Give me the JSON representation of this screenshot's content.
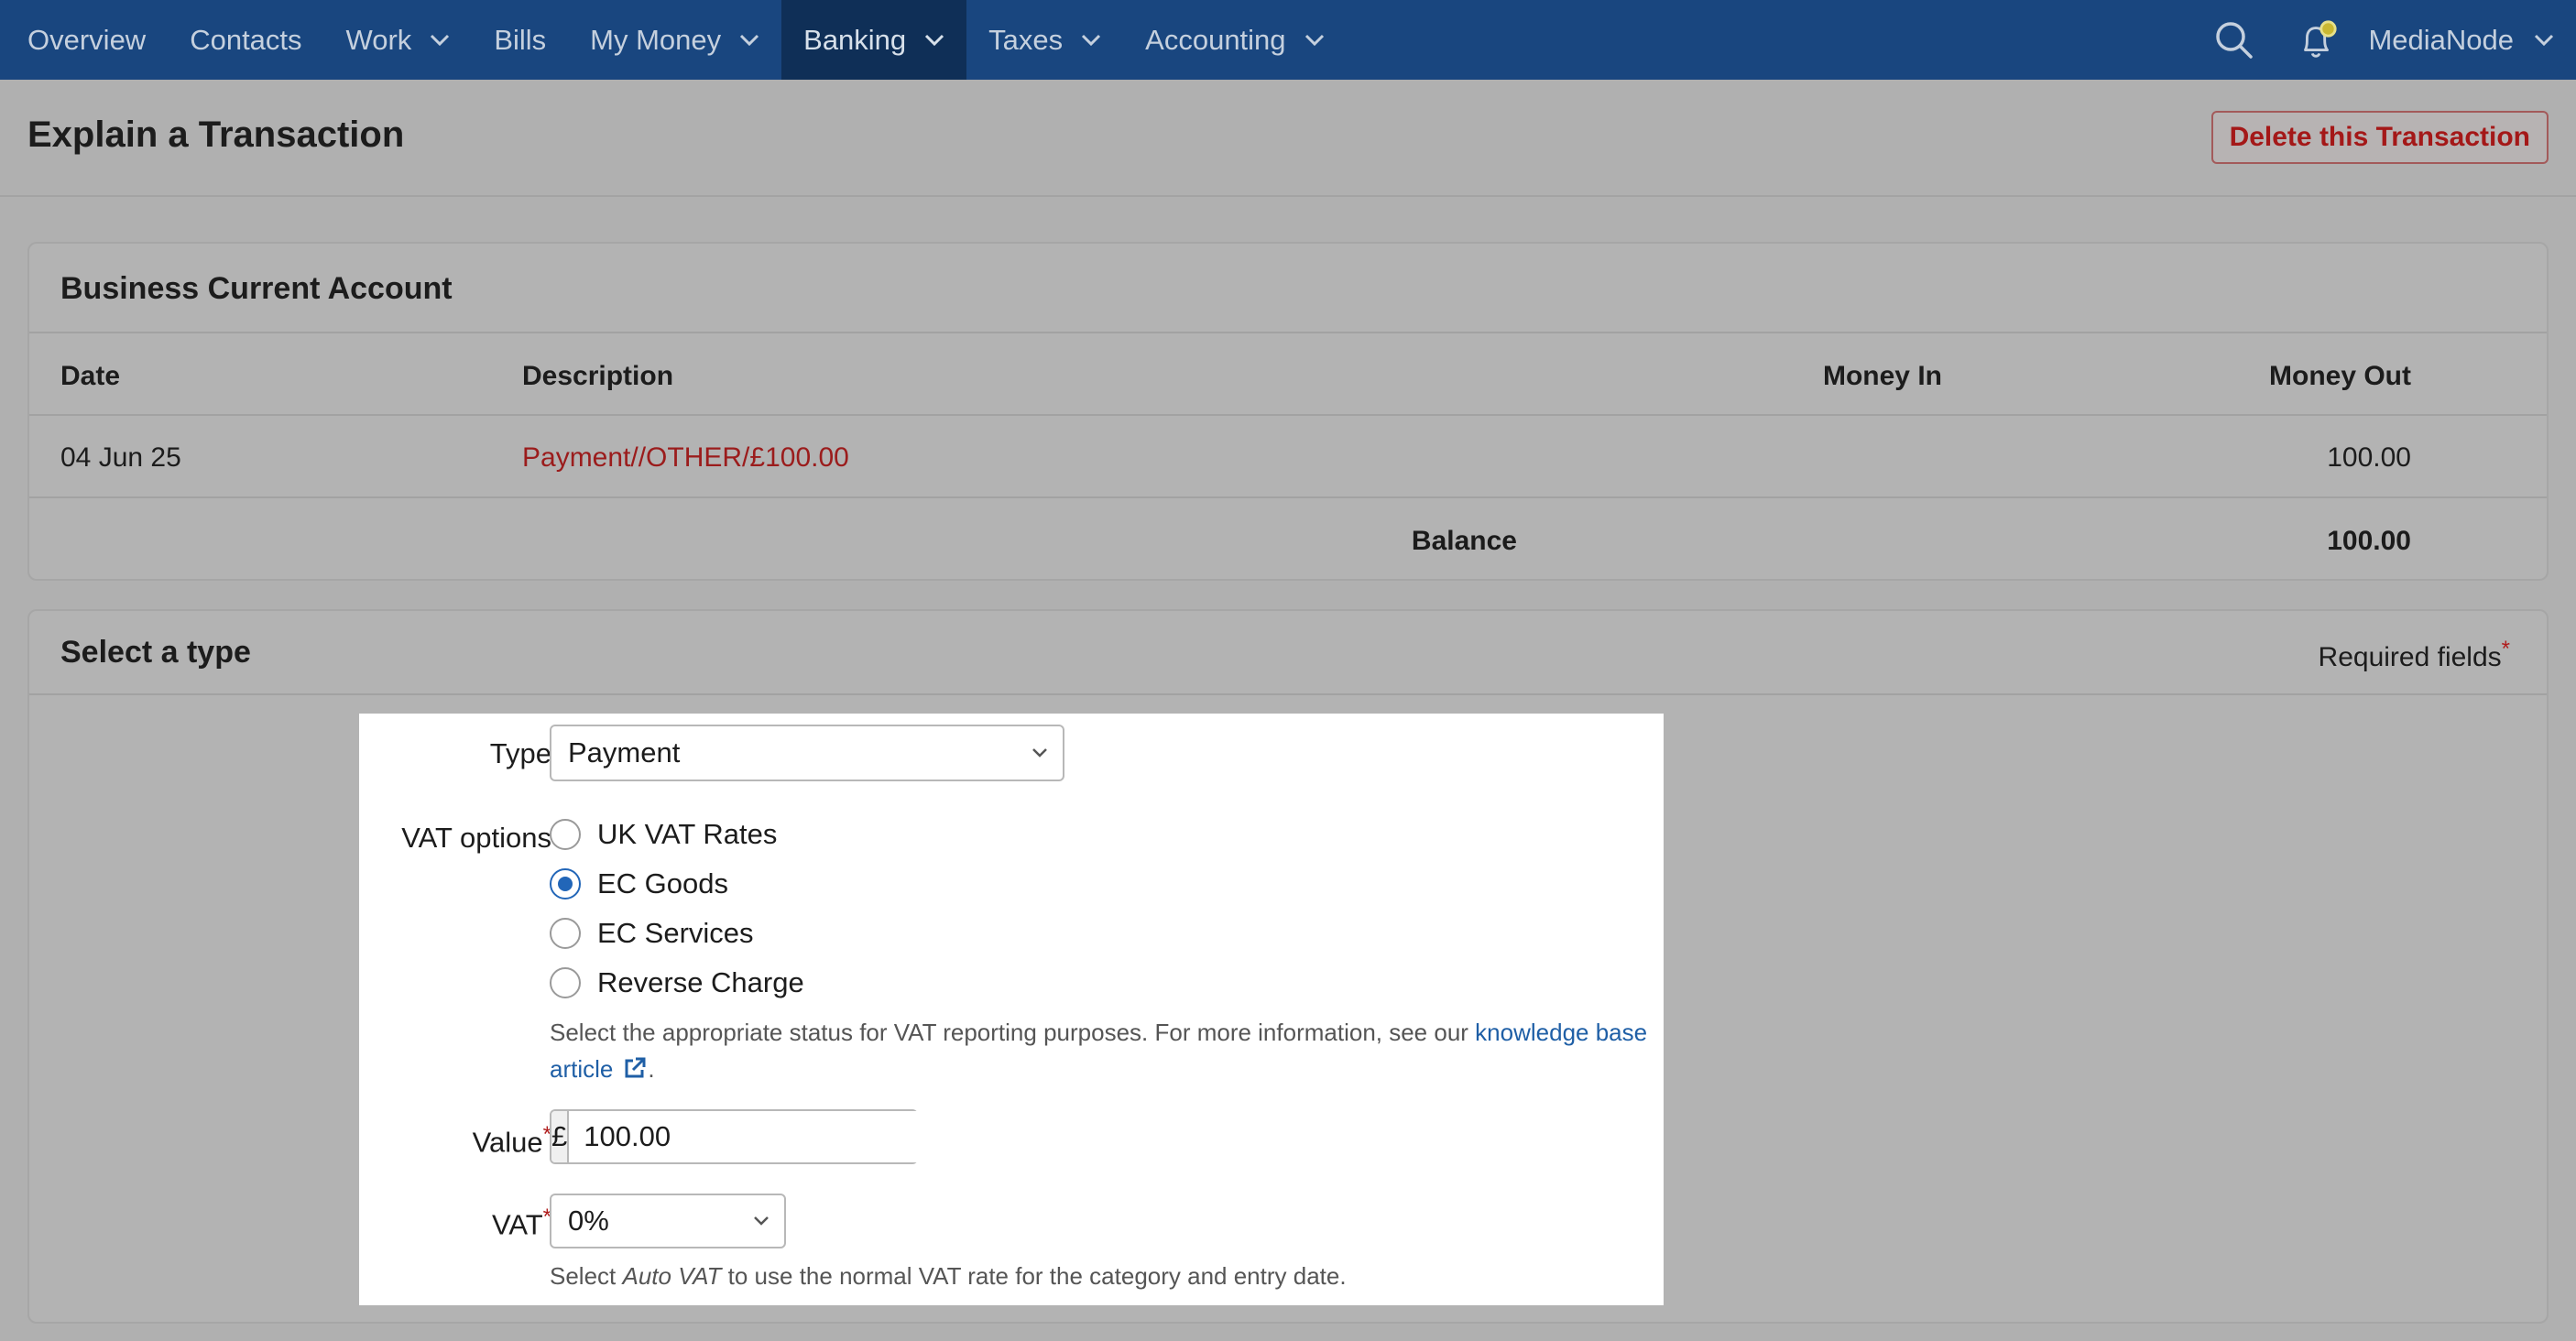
{
  "nav": {
    "items": [
      {
        "label": "Overview",
        "dropdown": false,
        "active": false
      },
      {
        "label": "Contacts",
        "dropdown": false,
        "active": false
      },
      {
        "label": "Work",
        "dropdown": true,
        "active": false
      },
      {
        "label": "Bills",
        "dropdown": false,
        "active": false
      },
      {
        "label": "My Money",
        "dropdown": true,
        "active": false
      },
      {
        "label": "Banking",
        "dropdown": true,
        "active": true
      },
      {
        "label": "Taxes",
        "dropdown": true,
        "active": false
      },
      {
        "label": "Accounting",
        "dropdown": true,
        "active": false
      }
    ],
    "account_name": "MediaNode",
    "icons": [
      "search-icon",
      "bell-icon"
    ],
    "colors": {
      "bar": "#19467f",
      "active": "#0f2f57"
    }
  },
  "header": {
    "title": "Explain a Transaction",
    "delete_label": "Delete this Transaction"
  },
  "account_panel": {
    "title": "Business Current Account",
    "columns": {
      "date": "Date",
      "description": "Description",
      "money_in": "Money In",
      "money_out": "Money Out"
    },
    "row": {
      "date": "04 Jun 25",
      "description": "Payment//OTHER/£100.00",
      "money_in": "",
      "money_out": "100.00"
    },
    "balance_label": "Balance",
    "balance_value": "100.00"
  },
  "type_panel": {
    "title": "Select a type",
    "required_label": "Required fields",
    "required_marker": "*"
  },
  "form": {
    "type_label": "Type",
    "type_value": "Payment",
    "vat_options_label": "VAT options",
    "vat_options": [
      "UK VAT Rates",
      "EC Goods",
      "EC Services",
      "Reverse Charge"
    ],
    "vat_selected": "EC Goods",
    "vat_help_prefix": "Select the appropriate status for VAT reporting purposes. For more information, see our ",
    "vat_help_link_line1": "knowledge base",
    "vat_help_link_line2": "article",
    "vat_help_suffix": ".",
    "value_label": "Value",
    "currency_symbol": "£",
    "value_amount": "100.00",
    "vat_label": "VAT",
    "vat_value": "0%",
    "vat_help_before": "Select ",
    "vat_help_em": "Auto VAT",
    "vat_help_after": " to use the normal VAT rate for the category and entry date."
  }
}
